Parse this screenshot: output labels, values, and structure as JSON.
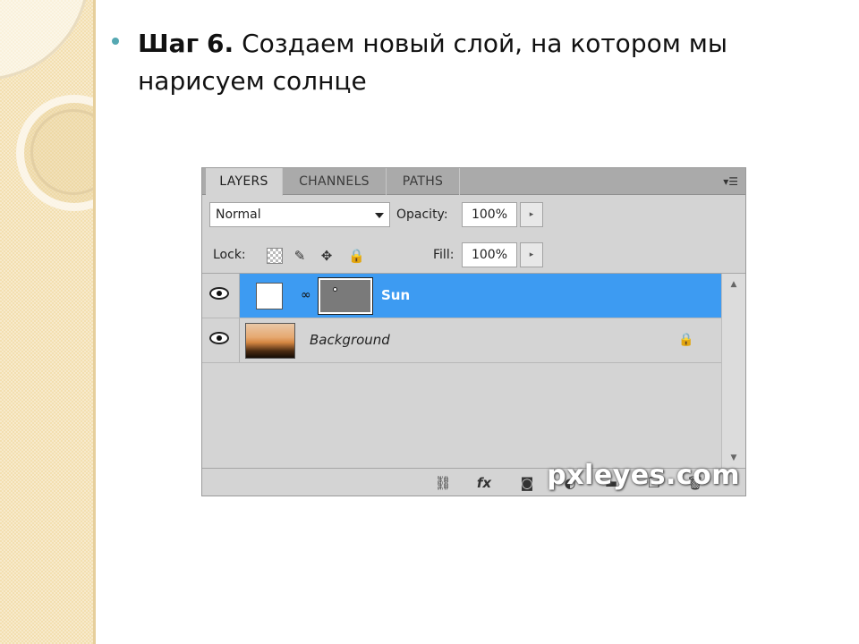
{
  "slide": {
    "step_label": "Шаг",
    "step_number": "6.",
    "text_line1": "Создаем новый слой, на котором мы",
    "text_line2": "нарисуем солнце"
  },
  "panel": {
    "tabs": [
      {
        "label": "LAYERS",
        "active": true
      },
      {
        "label": "CHANNELS",
        "active": false
      },
      {
        "label": "PATHS",
        "active": false
      }
    ],
    "menu_icon": "▾☰",
    "blend_mode": "Normal",
    "opacity_label": "Opacity:",
    "opacity_value": "100%",
    "lock_label": "Lock:",
    "fill_label": "Fill:",
    "fill_value": "100%",
    "stepper_glyph": "▸",
    "icons": {
      "lock_brush": "✎",
      "lock_move": "✥",
      "lock_all": "🔒",
      "chain": "∞",
      "bg_lock": "🔒",
      "link_layers": "⛓",
      "fx": "fx",
      "mask": "◙",
      "adjust": "◐",
      "group": "▬",
      "new_layer": "❐",
      "trash": "🗑",
      "scroll_up": "▲",
      "scroll_down": "▼"
    },
    "layers": [
      {
        "name": "Sun",
        "selected": true
      },
      {
        "name": "Background",
        "selected": false
      }
    ],
    "watermark": "pxleyes.com"
  },
  "colors": {
    "selection": "#3d9bf2",
    "bullet": "#55a8b2",
    "deco_band": "#f3dfb0"
  }
}
